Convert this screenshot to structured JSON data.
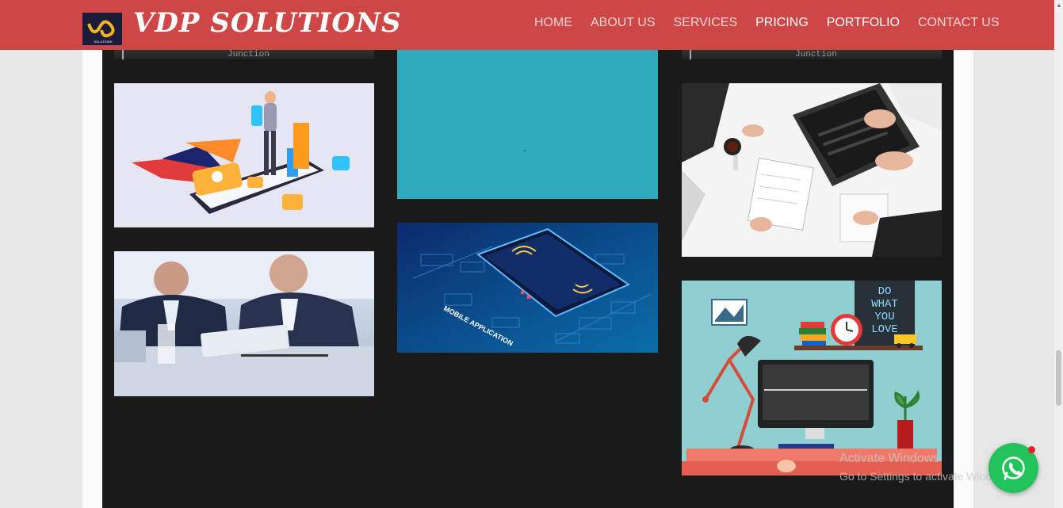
{
  "brand": {
    "name": "VDP SOLUTIONS",
    "logo_text": "SOLUTIONS"
  },
  "nav": {
    "items": [
      {
        "label": "HOME"
      },
      {
        "label": "ABOUT US"
      },
      {
        "label": "SERVICES"
      },
      {
        "label": "PRICING"
      },
      {
        "label": "PORTFOLIO"
      },
      {
        "label": "CONTACT US"
      }
    ]
  },
  "gallery": {
    "strip_caption": "Junction",
    "poster_text": "DO WHAT YOU LOVE",
    "phone_banner_text": "MOBILE APPLICATION"
  },
  "watermark": {
    "line1": "Activate Windows",
    "line2": "Go to Settings to activate Windows."
  },
  "colors": {
    "navbar": "#cf4646",
    "gallery_bg": "#1a1a1a",
    "whatsapp": "#22c35a"
  }
}
